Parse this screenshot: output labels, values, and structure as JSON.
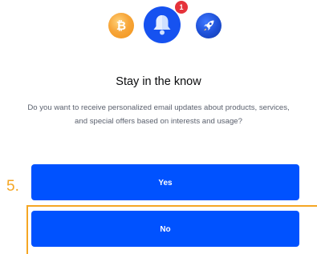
{
  "header": {
    "icons": [
      {
        "name": "bitcoin-coin-icon",
        "glyph": "₿"
      },
      {
        "name": "bell-icon"
      },
      {
        "name": "rocket-icon"
      }
    ],
    "notification_count": "1"
  },
  "dialog": {
    "title": "Stay in the know",
    "body": "Do you want to receive personalized email updates about products, services, and special offers based on interests and usage?"
  },
  "actions": {
    "yes_label": "Yes",
    "no_label": "No"
  },
  "annotation": {
    "step_label": "5."
  },
  "colors": {
    "primary": "#0052ff",
    "bell_circle": "#1652f0",
    "badge": "#e5333b",
    "bitcoin": "#f7a63a",
    "highlight": "#f5a623",
    "body_text": "#5b616e"
  }
}
